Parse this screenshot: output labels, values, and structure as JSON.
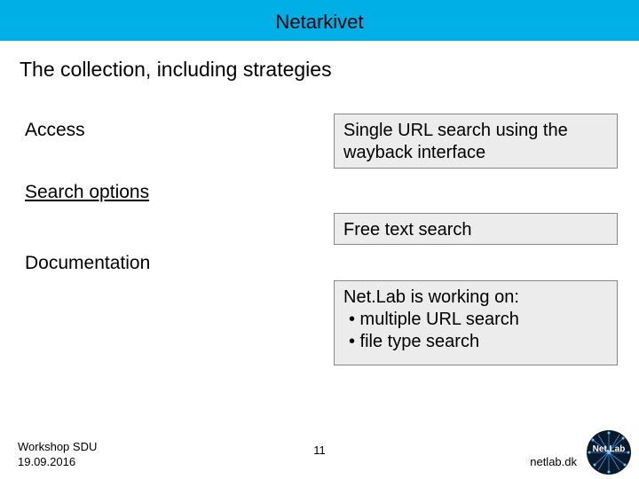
{
  "header": {
    "title": "Netarkivet"
  },
  "heading": "The collection, including strategies",
  "left": {
    "item1": "Access",
    "item2": "Search options",
    "item3": "Documentation"
  },
  "callouts": {
    "c1": "Single URL search using the wayback interface",
    "c2": "Free text search",
    "c3_intro": "Net.Lab is working on:",
    "c3_b1": "•  multiple URL search",
    "c3_b2": "•  file type search"
  },
  "footer": {
    "line1": "Workshop SDU",
    "line2": "19.09.2016",
    "page": "11",
    "url": "netlab.dk",
    "logo_label": "Net.Lab"
  }
}
